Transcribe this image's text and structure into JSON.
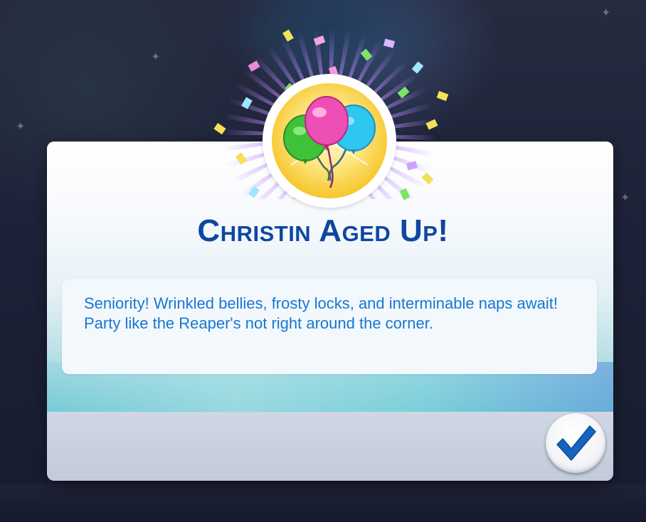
{
  "dialog": {
    "title": "Christin Aged Up!",
    "message": "Seniority! Wrinkled bellies, frosty locks, and interminable naps await! Party like the Reaper's not right around the corner.",
    "badge_icon": "balloons-icon",
    "confirm_icon": "checkmark-icon"
  },
  "colors": {
    "title": "#0d47a1",
    "message_text": "#1677d2",
    "checkmark": "#1565c0",
    "badge_gold": "#f7c933"
  }
}
